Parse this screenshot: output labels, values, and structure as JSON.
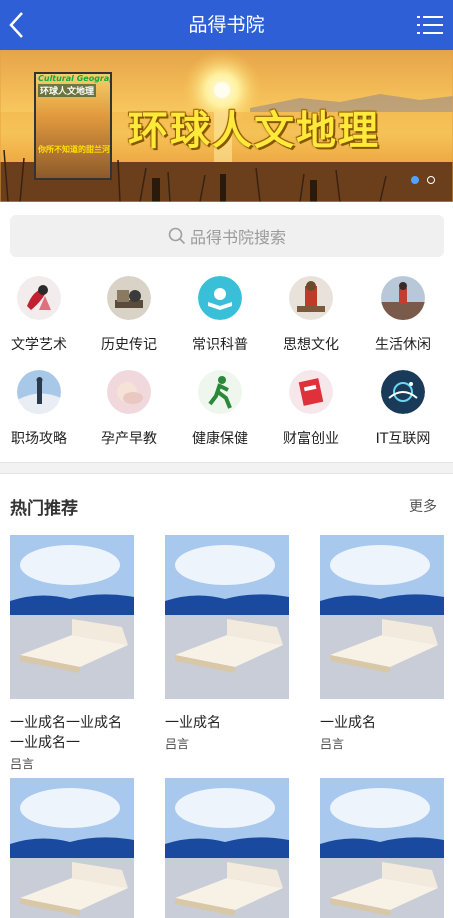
{
  "header": {
    "title": "品得书院",
    "back_icon": "chevron-left-icon",
    "menu_icon": "list-menu-icon",
    "color": "#2f5fd6"
  },
  "banner": {
    "headline": "环球人文地理",
    "magazine": {
      "top_text": "Cultural Geography",
      "title": "环球人文地理",
      "subtitle": "你所不知道的甜兰河"
    },
    "slides": 2,
    "active_slide": 1
  },
  "search": {
    "placeholder": "品得书院搜索",
    "icon": "search-icon"
  },
  "categories": [
    {
      "label": "文学艺术",
      "icon": "literature-art-icon"
    },
    {
      "label": "历史传记",
      "icon": "history-biography-icon"
    },
    {
      "label": "常识科普",
      "icon": "science-icon"
    },
    {
      "label": "思想文化",
      "icon": "thought-culture-icon"
    },
    {
      "label": "生活休闲",
      "icon": "leisure-icon"
    },
    {
      "label": "职场攻略",
      "icon": "career-icon"
    },
    {
      "label": "孕产早教",
      "icon": "baby-education-icon"
    },
    {
      "label": "健康保健",
      "icon": "health-icon"
    },
    {
      "label": "财富创业",
      "icon": "wealth-icon"
    },
    {
      "label": "IT互联网",
      "icon": "it-internet-icon"
    }
  ],
  "hot": {
    "title": "热门推荐",
    "more": "更多",
    "books": [
      {
        "name": "一业成名一业成名一业成名一",
        "author": "吕言"
      },
      {
        "name": "一业成名",
        "author": "吕言"
      },
      {
        "name": "一业成名",
        "author": "吕言"
      },
      {
        "name": "",
        "author": ""
      },
      {
        "name": "",
        "author": ""
      },
      {
        "name": "",
        "author": ""
      }
    ]
  }
}
